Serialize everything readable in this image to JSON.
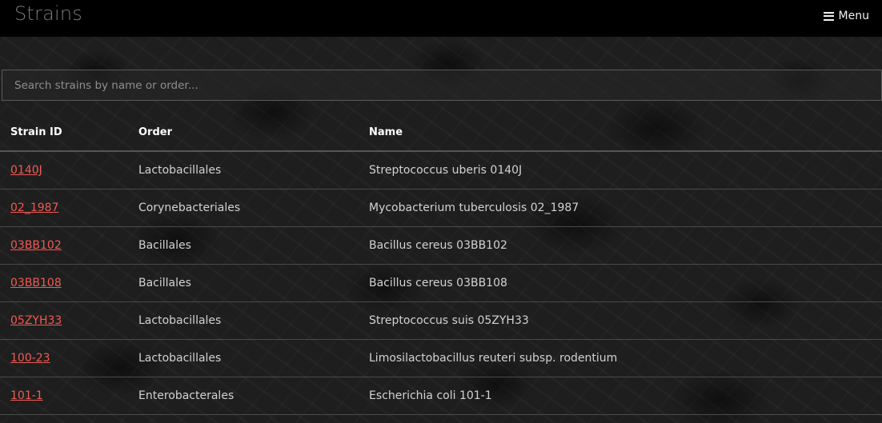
{
  "header": {
    "title": "Strains",
    "menu_label": "Menu",
    "menu_icon": "hamburger-icon"
  },
  "search": {
    "placeholder": "Search strains by name or order...",
    "value": ""
  },
  "table": {
    "columns": [
      "Strain ID",
      "Order",
      "Name"
    ],
    "rows": [
      {
        "id": "0140J",
        "order": "Lactobacillales",
        "name": "Streptococcus uberis 0140J"
      },
      {
        "id": "02_1987",
        "order": "Corynebacteriales",
        "name": "Mycobacterium tuberculosis 02_1987"
      },
      {
        "id": "03BB102",
        "order": "Bacillales",
        "name": "Bacillus cereus 03BB102"
      },
      {
        "id": "03BB108",
        "order": "Bacillales",
        "name": "Bacillus cereus 03BB108"
      },
      {
        "id": "05ZYH33",
        "order": "Lactobacillales",
        "name": "Streptococcus suis 05ZYH33"
      },
      {
        "id": "100-23",
        "order": "Lactobacillales",
        "name": "Limosilactobacillus reuteri subsp. rodentium"
      },
      {
        "id": "101-1",
        "order": "Enterobacterales",
        "name": "Escherichia coli 101-1"
      }
    ]
  },
  "colors": {
    "link": "#ef5a55",
    "topbar": "#000000",
    "title": "#7a7a7a"
  }
}
